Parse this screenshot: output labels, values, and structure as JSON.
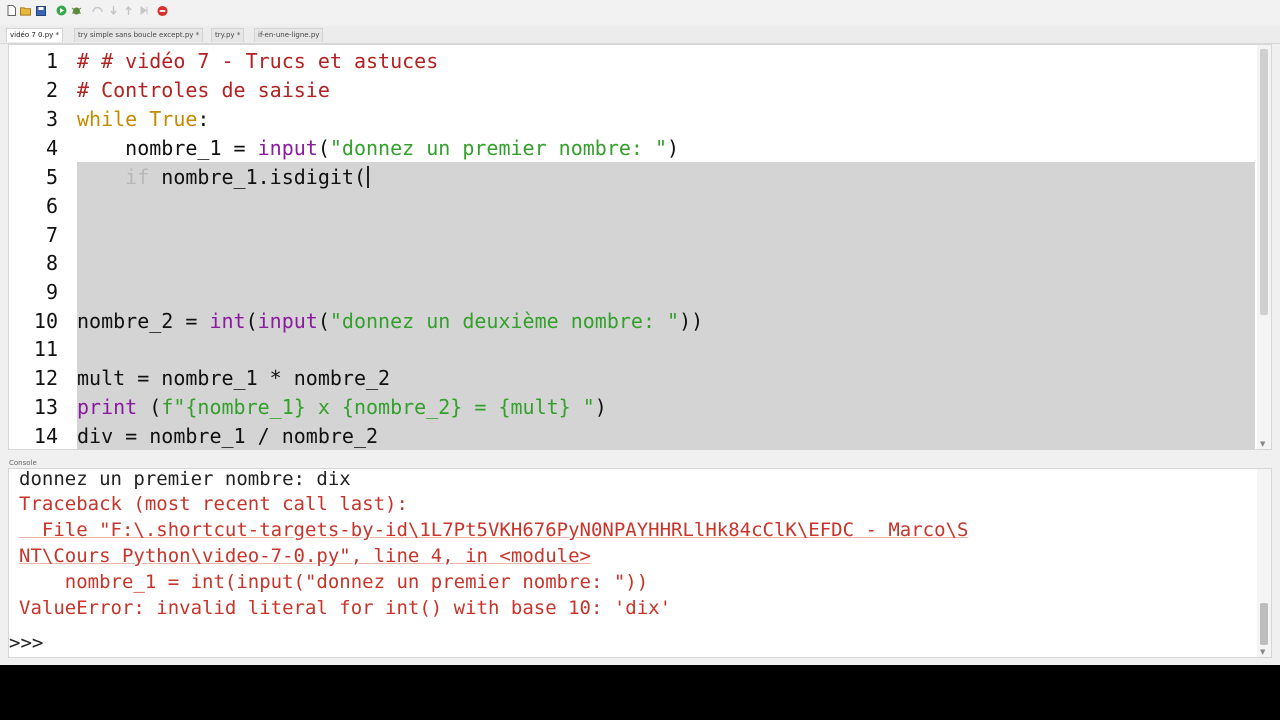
{
  "toolbar": {
    "icons": [
      "new-file-icon",
      "open-folder-icon",
      "save-icon",
      "run-icon",
      "debug-icon",
      "step-over-icon",
      "step-into-icon",
      "step-out-icon",
      "resume-icon",
      "stop-icon"
    ]
  },
  "tabs": [
    {
      "label": "vidéo 7 0.py *",
      "active": true
    },
    {
      "label": "try simple sans boucle except.py *",
      "active": false
    },
    {
      "label": "try.py *",
      "active": false
    },
    {
      "label": "if-en-une-ligne.py",
      "active": false
    }
  ],
  "editor": {
    "line_numbers": [
      "1",
      "2",
      "3",
      "4",
      "5",
      "6",
      "7",
      "8",
      "9",
      "10",
      "11",
      "12",
      "13",
      "14"
    ],
    "lines": {
      "l1": "# # vidéo 7 - Trucs et astuces",
      "l2": "# Controles de saisie",
      "l3_kw": "while True",
      "l3_rest": ":",
      "l4_a": "    nombre_1 = ",
      "l4_fn": "input",
      "l4_b": "(",
      "l4_str": "\"donnez un premier nombre: \"",
      "l4_c": ")",
      "l5_indent": "    ",
      "l5_kw": "if",
      "l5_rest": " nombre_1.isdigit(",
      "l10_a": "nombre_2 = ",
      "l10_fn1": "int",
      "l10_b": "(",
      "l10_fn2": "input",
      "l10_c": "(",
      "l10_str": "\"donnez un deuxième nombre: \"",
      "l10_d": "))",
      "l12": "mult = nombre_1 * nombre_2",
      "l13_fn": "print",
      "l13_a": " (",
      "l13_str": "f\"{nombre_1} x {nombre_2} = {mult} \"",
      "l13_b": ")",
      "l14": "div = nombre_1 / nombre_2"
    }
  },
  "console": {
    "label": "Console",
    "lines": [
      "donnez un premier nombre: dix",
      "Traceback (most recent call last):",
      "  File \"F:\\.shortcut-targets-by-id\\1L7Pt5VKH676PyN0NPAYHHRLlHk84cClK\\EFDC - Marco\\S",
      "NT\\Cours Python\\video-7-0.py\", line 4, in <module>",
      "    nombre_1 = int(input(\"donnez un premier nombre: \"))",
      "ValueError: invalid literal for int() with base 10: 'dix'"
    ],
    "prompt": ">>>"
  },
  "colors": {
    "comment": "#b22222",
    "keyword": "#c58b00",
    "builtin": "#8a1a9e",
    "string": "#33a02c",
    "error": "#c8342a",
    "selection": "#d4d4d4"
  }
}
